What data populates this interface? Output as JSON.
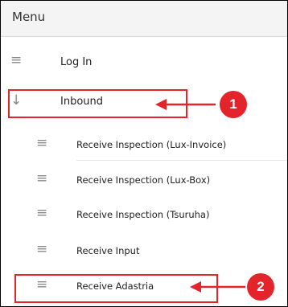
{
  "menu": {
    "title": "Menu",
    "items": [
      {
        "label": "Log In",
        "icon": "list-icon"
      },
      {
        "label": "Inbound",
        "icon": "arrow-down-icon"
      }
    ],
    "subitems": [
      {
        "label": "Receive Inspection (Lux-Invoice)",
        "icon": "list-icon"
      },
      {
        "label": "Receive Inspection (Lux-Box)",
        "icon": "list-icon"
      },
      {
        "label": "Receive Inspection (Tsuruha)",
        "icon": "list-icon"
      },
      {
        "label": "Receive Input",
        "icon": "list-icon"
      },
      {
        "label": "Receive Adastria",
        "icon": "list-icon"
      }
    ]
  },
  "callouts": [
    {
      "number": "1"
    },
    {
      "number": "2"
    }
  ],
  "colors": {
    "accent": "#e3252b",
    "icon": "#8a8a8a",
    "header_bg": "#f4f4f4"
  }
}
